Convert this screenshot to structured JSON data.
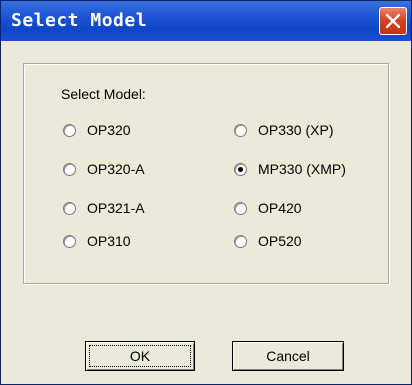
{
  "window": {
    "title": "Select Model"
  },
  "group": {
    "label": "Select Model:"
  },
  "options": {
    "op320": "OP320",
    "op320a": "OP320-A",
    "op321a": "OP321-A",
    "op310": "OP310",
    "op330": "OP330 (XP)",
    "mp330": "MP330 (XMP)",
    "op420": "OP420",
    "op520": "OP520"
  },
  "selected": "MP330 (XMP)",
  "buttons": {
    "ok": "OK",
    "cancel": "Cancel"
  },
  "colors": {
    "titlebar": "#1b54d6",
    "close": "#d4411e",
    "face": "#ece9d8"
  }
}
